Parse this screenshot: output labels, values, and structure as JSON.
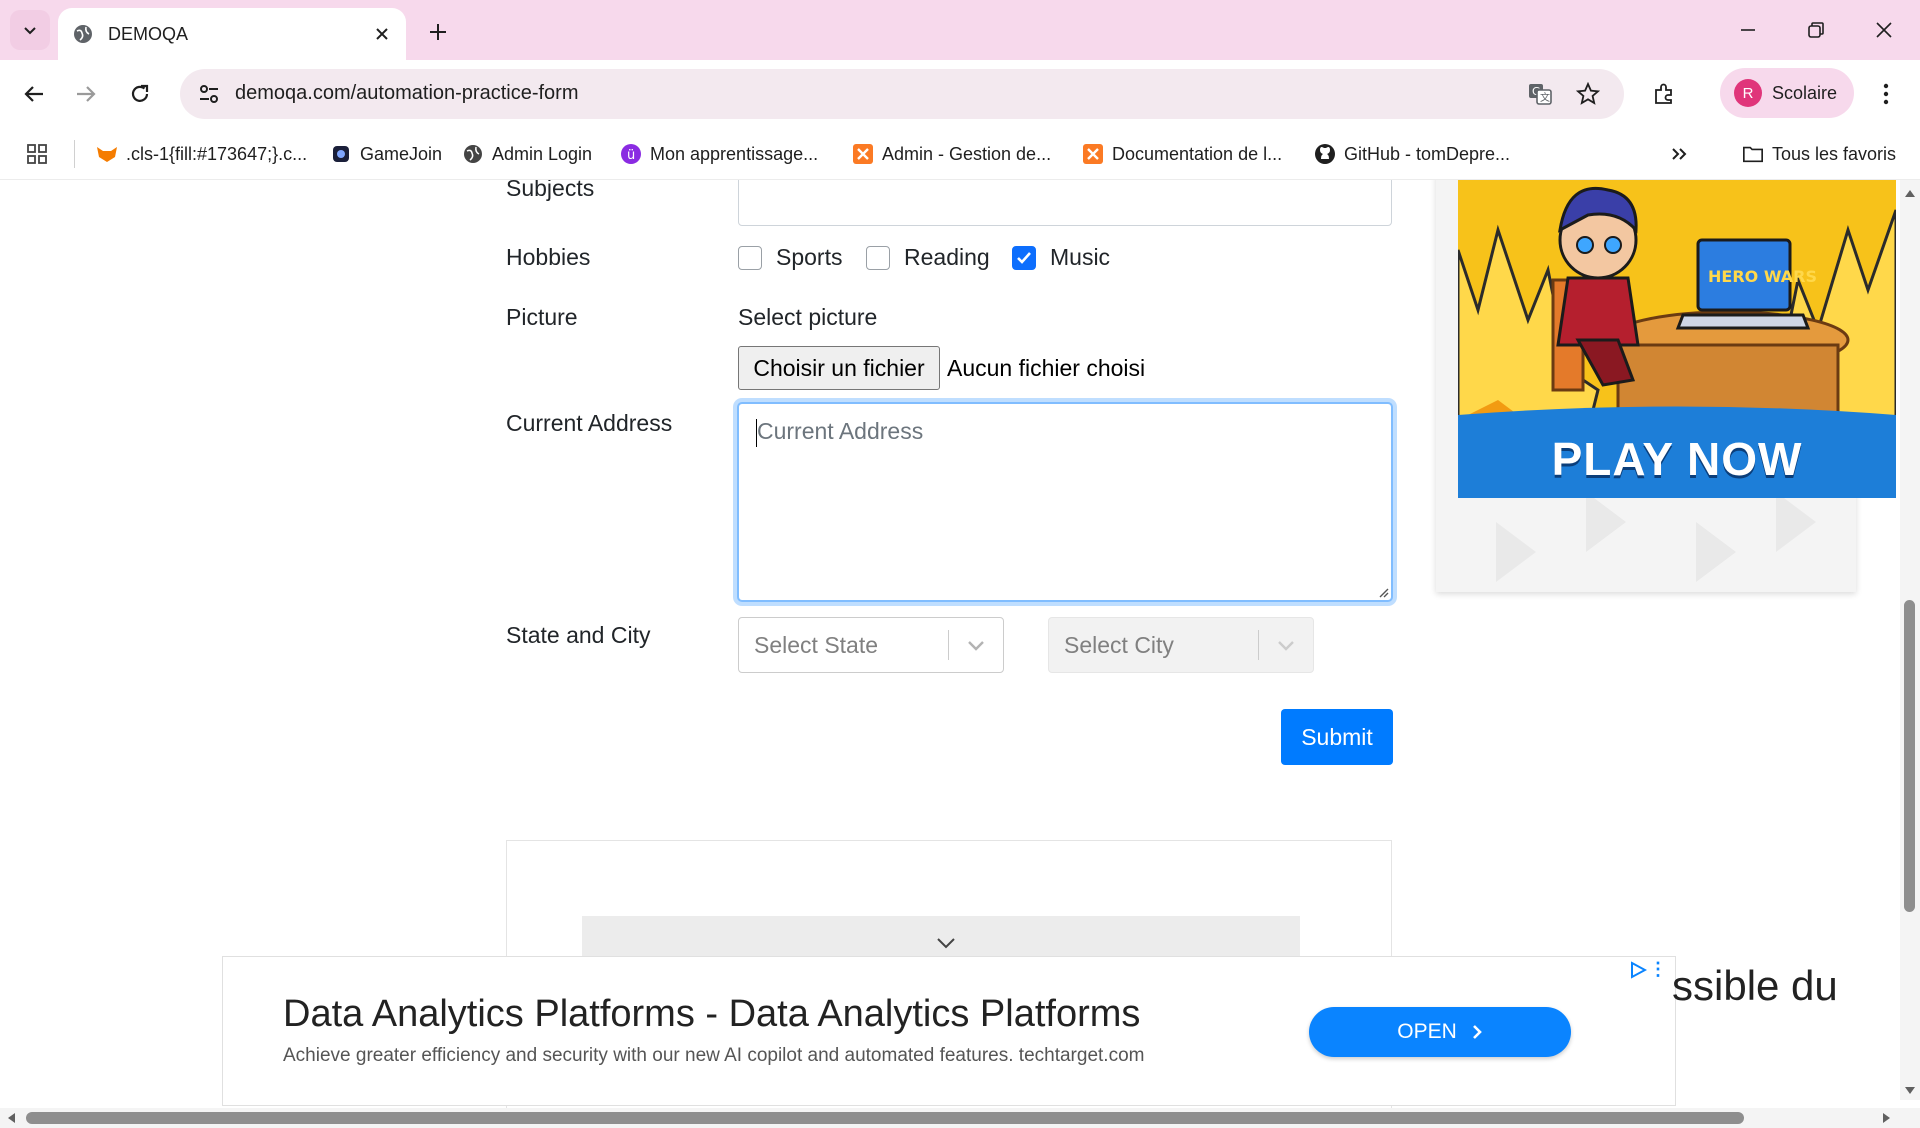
{
  "browser": {
    "tab_title": "DEMOQA",
    "url": "demoqa.com/automation-practice-form",
    "profile_initial": "R",
    "profile_name": "Scolaire",
    "bookmarks": [
      {
        "label": ".cls-1{fill:#173647;}.c...",
        "icon": "fox-icon"
      },
      {
        "label": "GameJoin",
        "icon": "game-icon"
      },
      {
        "label": "Admin Login",
        "icon": "globe-icon"
      },
      {
        "label": "Mon apprentissage...",
        "icon": "learning-icon"
      },
      {
        "label": "Admin - Gestion de...",
        "icon": "xampp-icon"
      },
      {
        "label": "Documentation de l...",
        "icon": "xampp-icon"
      },
      {
        "label": "GitHub - tomDepre...",
        "icon": "github-icon"
      }
    ],
    "all_bookmarks": "Tous les favoris"
  },
  "form": {
    "subjects_label": "Subjects",
    "hobbies_label": "Hobbies",
    "hobbies": [
      {
        "label": "Sports",
        "checked": false
      },
      {
        "label": "Reading",
        "checked": false
      },
      {
        "label": "Music",
        "checked": true
      }
    ],
    "picture_label": "Picture",
    "select_picture": "Select picture",
    "file_button": "Choisir un fichier",
    "file_status": "Aucun fichier choisi",
    "address_label": "Current Address",
    "address_placeholder": "Current Address",
    "state_city_label": "State and City",
    "state_placeholder": "Select State",
    "city_placeholder": "Select City",
    "submit": "Submit"
  },
  "side_ad": {
    "cta": "PLAY NOW",
    "game_logo": "HERO WARS"
  },
  "bottom_ad": {
    "title": "Data Analytics Platforms - Data Analytics Platforms",
    "description": "Achieve greater efficiency and security with our new AI copilot and automated features. techtarget.com",
    "button": "OPEN",
    "behind_text": "ssible du"
  },
  "colors": {
    "accent": "#007bff",
    "tabbar": "#f7d9ec",
    "checkbox_checked": "#0d6efd"
  }
}
